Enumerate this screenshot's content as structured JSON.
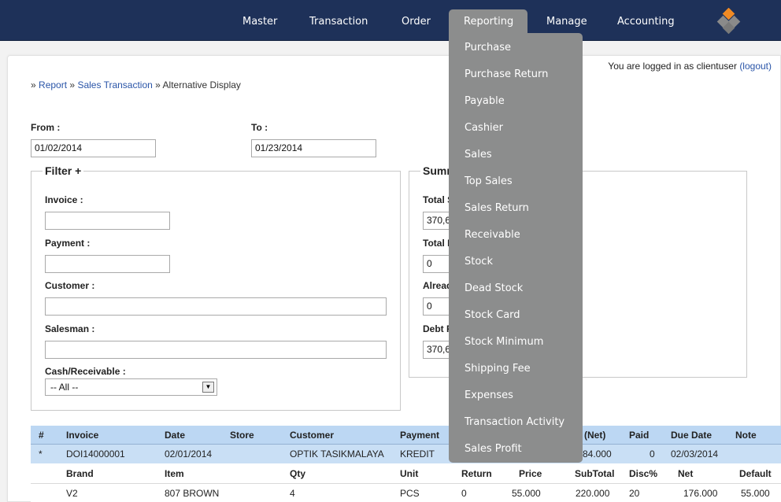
{
  "nav": {
    "items": [
      {
        "label": "Master"
      },
      {
        "label": "Transaction"
      },
      {
        "label": "Order"
      },
      {
        "label": "Reporting"
      },
      {
        "label": "Manage"
      },
      {
        "label": "Accounting"
      }
    ],
    "active": "Reporting"
  },
  "login": {
    "prefix": "You are logged in as clientuser",
    "logout_label": "(logout)"
  },
  "breadcrumb": {
    "sep": "»",
    "report": "Report",
    "sales_transaction": "Sales Transaction",
    "current": "Alternative Display"
  },
  "dates": {
    "from_label": "From :",
    "from_value": "01/02/2014",
    "to_label": "To :",
    "to_value": "01/23/2014"
  },
  "filter": {
    "legend": "Filter +",
    "invoice_label": "Invoice :",
    "invoice_value": "",
    "payment_label": "Payment :",
    "payment_value": "",
    "customer_label": "Customer :",
    "customer_value": "",
    "salesman_label": "Salesman :",
    "salesman_value": "",
    "cash_label": "Cash/Receivable :",
    "cash_value": "-- All --"
  },
  "summary": {
    "legend": "Summ",
    "total_s_label": "Total S",
    "total_s_value": "370,6",
    "total_d_label": "Total D",
    "total_d_value": "0",
    "already_label": "Alread",
    "already_value": "0",
    "debt_label": "Debt R",
    "debt_value": "370,6"
  },
  "table": {
    "headers": [
      "#",
      "Invoice",
      "Date",
      "Store",
      "Customer",
      "Payment",
      "(Net)",
      "Paid",
      "Due Date",
      "Note"
    ],
    "row": {
      "mark": "*",
      "invoice": "DOI14000001",
      "date": "02/01/2014",
      "customer": "OPTIK TASIKMALAYA",
      "payment": "KREDIT",
      "net": "84.000",
      "paid": "0",
      "due_date": "02/03/2014"
    },
    "sub_headers": [
      "Brand",
      "Item",
      "Qty",
      "Unit",
      "Return",
      "Price",
      "SubTotal",
      "Disc%",
      "Net",
      "Default"
    ],
    "sub_row": {
      "brand": "V2",
      "item": "807 BROWN",
      "qty": "4",
      "unit": "PCS",
      "return": "0",
      "price": "55.000",
      "subtotal": "220.000",
      "disc": "20",
      "net": "176.000",
      "default": "55.000"
    }
  },
  "reporting_menu": [
    "Purchase",
    "Purchase Return",
    "Payable",
    "Cashier",
    "Sales",
    "Top Sales",
    "Sales Return",
    "Receivable",
    "Stock",
    "Dead Stock",
    "Stock Card",
    "Stock Minimum",
    "Shipping Fee",
    "Expenses",
    "Transaction Activity",
    "Sales Profit"
  ],
  "colors": {
    "topbar": "#1e3159",
    "menu": "#8c8d8d",
    "table_header": "#bcd7f3",
    "link": "#2a55a8",
    "logo_orange": "#f08a24",
    "logo_gray": "#8a8a8a"
  },
  "icons": {
    "logo": "diamond-logo-icon",
    "select_arrow": "chevron-down-icon"
  }
}
